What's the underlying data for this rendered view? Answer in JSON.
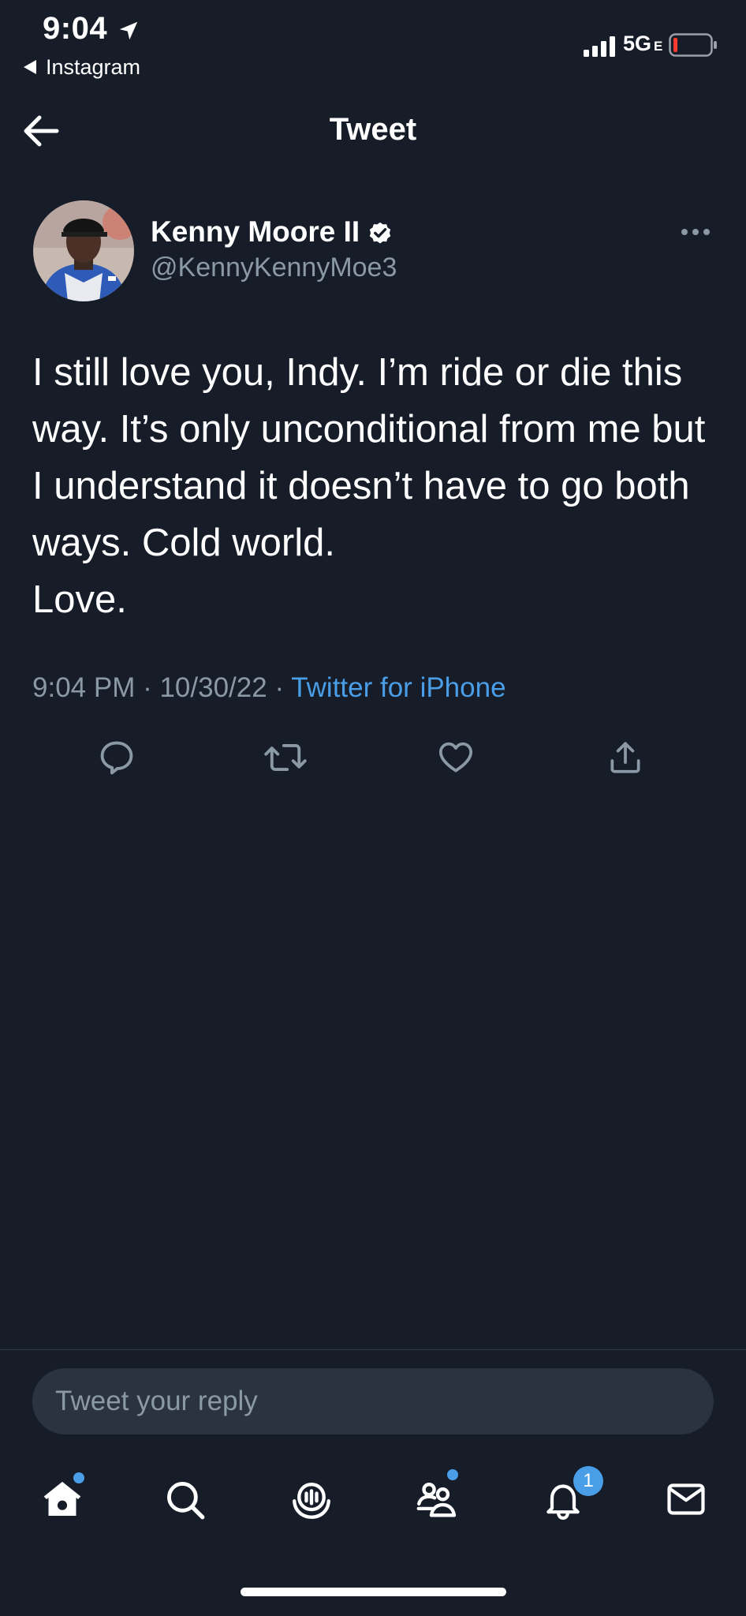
{
  "status_bar": {
    "time": "9:04",
    "back_app": "Instagram",
    "network": "5G",
    "network_suffix": "E"
  },
  "header": {
    "title": "Tweet"
  },
  "tweet": {
    "author_name": "Kenny Moore II",
    "author_handle": "@KennyKennyMoe3",
    "text": "I still love you, Indy. I’m ride or die this way. It’s only unconditional from me but I understand it doesn’t have to go both ways. Cold world.\nLove.",
    "time": "9:04 PM",
    "date": "10/30/22",
    "source": "Twitter for iPhone"
  },
  "reply": {
    "placeholder": "Tweet your reply"
  },
  "tab_bar": {
    "notifications_badge": "1"
  },
  "colors": {
    "background": "#161c28",
    "accent": "#4a9ee8",
    "secondary_text": "#8b98a5"
  }
}
